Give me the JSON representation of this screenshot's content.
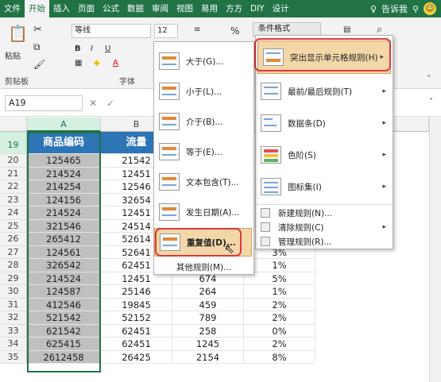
{
  "tabs": [
    "文件",
    "开始",
    "插入",
    "页面",
    "公式",
    "数据",
    "审阅",
    "视图",
    "易用",
    "方方",
    "DIY",
    "设计"
  ],
  "tell_me": "告诉我",
  "ribbon": {
    "paste_label": "粘贴",
    "clipboard_label": "剪贴板",
    "font_label": "字体",
    "font_name": "等线",
    "font_size": "12",
    "bold": "B",
    "italic": "I",
    "underline": "U",
    "percent": "%",
    "conditional_format": "条件格式"
  },
  "formula_bar": {
    "namebox": "A19",
    "cancel": "✕",
    "confirm": "✓"
  },
  "columns": [
    "A",
    "B"
  ],
  "header_row": {
    "row": "19",
    "a": "商品编码",
    "b": "流量"
  },
  "rows": [
    {
      "row": "20",
      "a": "125465",
      "b": "21542",
      "c": "",
      "d": ""
    },
    {
      "row": "21",
      "a": "214524",
      "b": "12451",
      "c": "",
      "d": ""
    },
    {
      "row": "22",
      "a": "214254",
      "b": "12546",
      "c": "",
      "d": ""
    },
    {
      "row": "23",
      "a": "124156",
      "b": "32654",
      "c": "",
      "d": ""
    },
    {
      "row": "24",
      "a": "214524",
      "b": "12451",
      "c": "",
      "d": ""
    },
    {
      "row": "25",
      "a": "321546",
      "b": "24514",
      "c": "",
      "d": ""
    },
    {
      "row": "26",
      "a": "265412",
      "b": "52614",
      "c": "",
      "d": ""
    },
    {
      "row": "27",
      "a": "124561",
      "b": "52641",
      "c": "",
      "d": "3%"
    },
    {
      "row": "28",
      "a": "326542",
      "b": "62451",
      "c": "",
      "d": "1%"
    },
    {
      "row": "29",
      "a": "214524",
      "b": "12451",
      "c": "674",
      "d": "5%"
    },
    {
      "row": "30",
      "a": "124587",
      "b": "25146",
      "c": "264",
      "d": "1%"
    },
    {
      "row": "31",
      "a": "412546",
      "b": "19845",
      "c": "459",
      "d": "2%"
    },
    {
      "row": "32",
      "a": "521542",
      "b": "52152",
      "c": "789",
      "d": "2%"
    },
    {
      "row": "33",
      "a": "621542",
      "b": "62451",
      "c": "258",
      "d": "0%"
    },
    {
      "row": "34",
      "a": "625415",
      "b": "62451",
      "c": "1245",
      "d": "2%"
    },
    {
      "row": "35",
      "a": "2612458",
      "b": "26425",
      "c": "2154",
      "d": "8%"
    }
  ],
  "highlight_menu": {
    "items": [
      "大于(G)...",
      "小于(L)...",
      "介于(B)...",
      "等于(E)...",
      "文本包含(T)...",
      "发生日期(A)...",
      "重复值(D)..."
    ],
    "other": "其他规则(M)..."
  },
  "cf_menu": {
    "items": [
      "突出显示单元格规则(H)",
      "最前/最后规则(T)",
      "数据条(D)",
      "色阶(S)",
      "图标集(I)"
    ],
    "small_items": [
      "新建规则(N)...",
      "清除规则(C)",
      "管理规则(R)..."
    ]
  },
  "colors": {
    "excel_green": "#217346",
    "header_blue": "#2e75b6",
    "highlight": "#f3d7a8",
    "ring": "#e0383e"
  }
}
